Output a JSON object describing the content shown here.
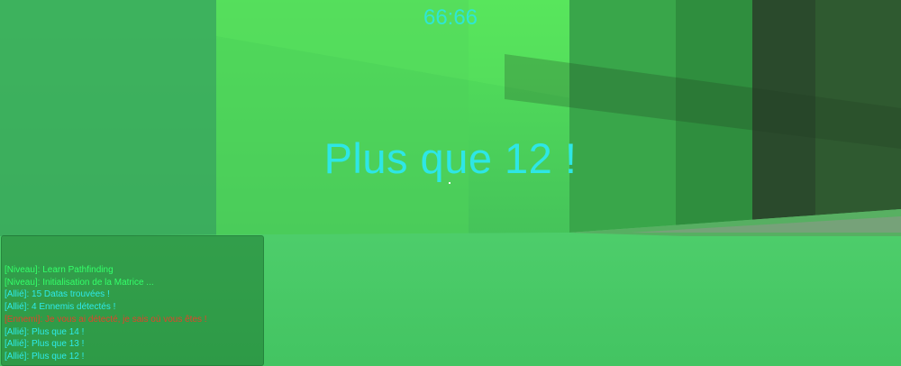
{
  "hud": {
    "timer": "66:66",
    "center_message": "Plus que 12 !"
  },
  "log": {
    "lines": [
      {
        "text": "[Niveau]: Learn Pathfinding",
        "kind": "level"
      },
      {
        "text": "[Niveau]: Initialisation de la Matrice ...",
        "kind": "level"
      },
      {
        "text": "[Allié]: 15 Datas trouvées !",
        "kind": "ally"
      },
      {
        "text": "[Allié]: 4 Ennemis détectés !",
        "kind": "ally"
      },
      {
        "text": "[Ennemi]: Je vous ai détecté, je sais où vous êtes !",
        "kind": "enemy"
      },
      {
        "text": "[Allié]: Plus que 14 !",
        "kind": "ally"
      },
      {
        "text": "[Allié]: Plus que 13 !",
        "kind": "ally"
      },
      {
        "text": "[Allié]: Plus que 12 !",
        "kind": "ally"
      }
    ]
  },
  "colors": {
    "level": "#34ff6a",
    "ally": "#2eeaea",
    "enemy": "#e0442a",
    "hud_text": "#2ee6e6"
  }
}
